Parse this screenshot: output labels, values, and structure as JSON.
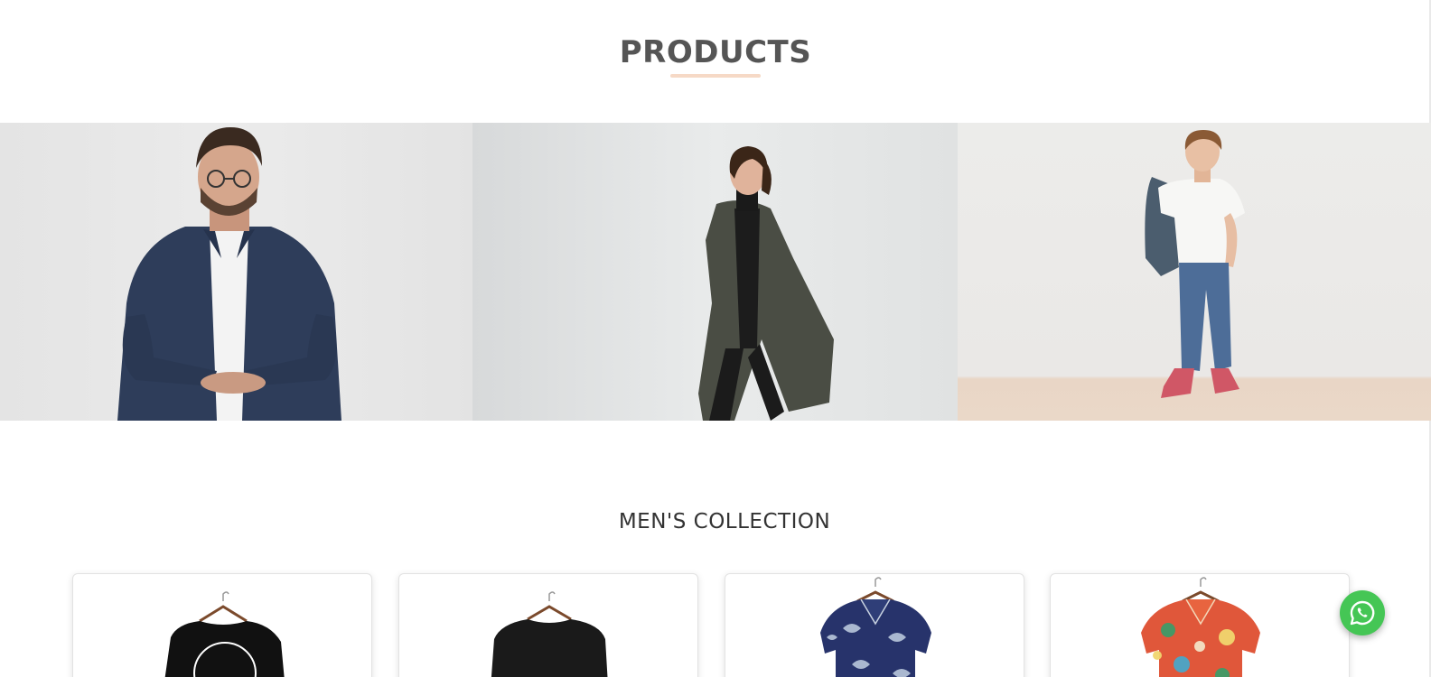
{
  "products": {
    "title": "PRODUCTS"
  },
  "banner": {
    "panels": [
      {
        "icon": "man-in-shirt-photo"
      },
      {
        "icon": "woman-in-coat-photo"
      },
      {
        "icon": "boy-in-jeans-photo"
      }
    ]
  },
  "mens_collection": {
    "title": "MEN'S COLLECTION",
    "cards": [
      {
        "icon": "black-tshirt-photo"
      },
      {
        "icon": "black-sweater-photo"
      },
      {
        "icon": "blue-floral-shirt-photo"
      },
      {
        "icon": "red-floral-shirt-photo"
      }
    ]
  },
  "floating": {
    "icon": "whatsapp-icon",
    "color": "#45c655"
  },
  "colors": {
    "title": "#555555",
    "underline": "#f6d9c6"
  }
}
